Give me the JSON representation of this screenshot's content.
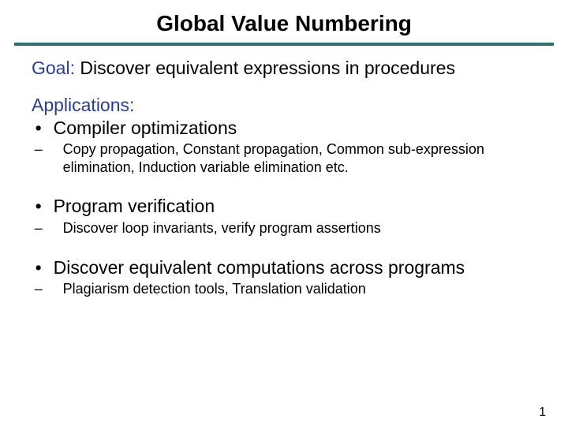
{
  "title": "Global Value Numbering",
  "goal": {
    "label": "Goal:",
    "text": " Discover equivalent expressions in procedures"
  },
  "apps_label": "Applications:",
  "bullets": [
    {
      "text": "Compiler optimizations",
      "subs": [
        "Copy propagation, Constant propagation, Common sub-expression elimination, Induction variable elimination etc."
      ]
    },
    {
      "text": "Program verification",
      "subs": [
        "Discover loop invariants, verify program assertions"
      ]
    },
    {
      "text": "Discover equivalent computations across programs",
      "subs": [
        "Plagiarism detection tools, Translation validation"
      ]
    }
  ],
  "page_number": "1"
}
